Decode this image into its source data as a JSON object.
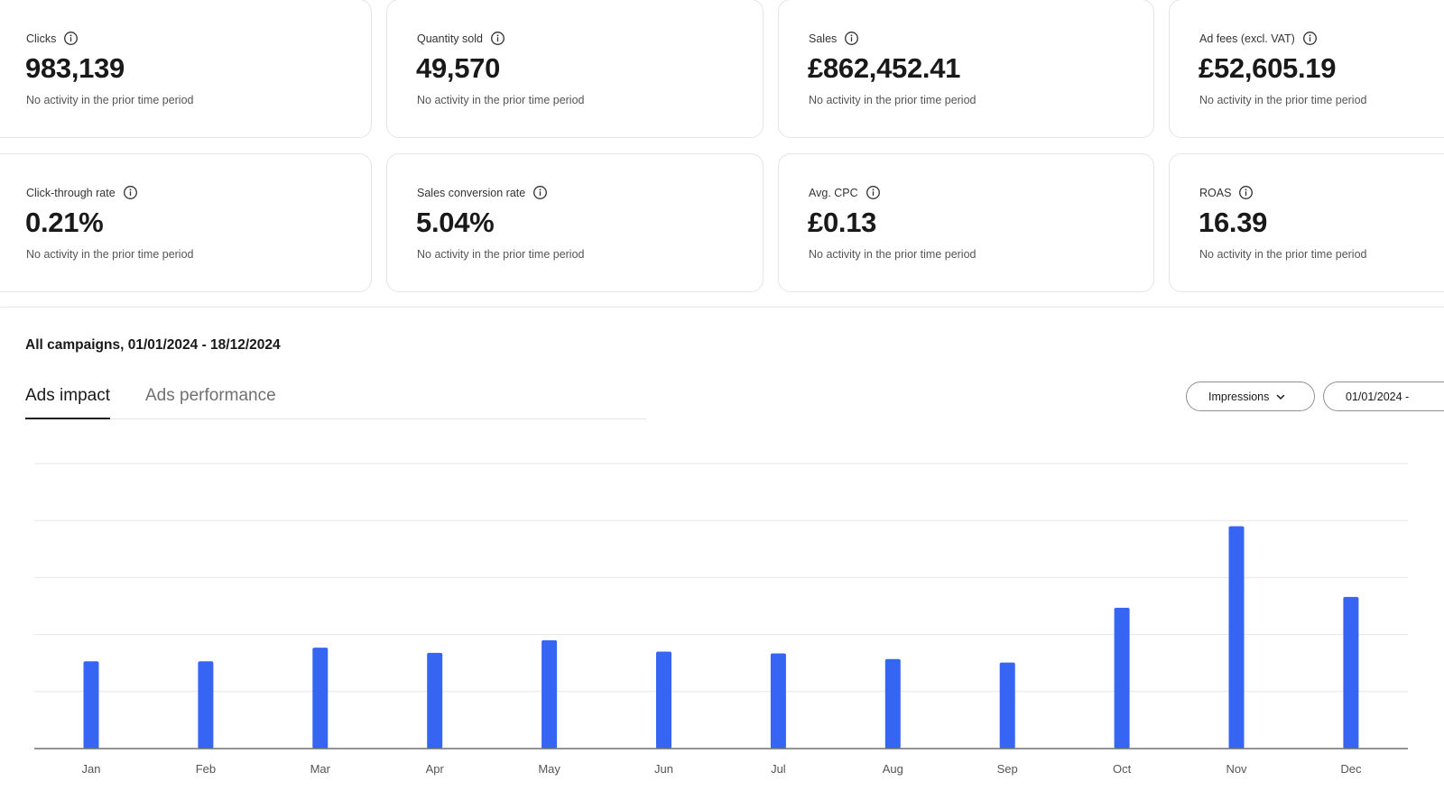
{
  "metrics": [
    {
      "label": "Clicks",
      "value": "983,139",
      "sub": "No activity in the prior time period"
    },
    {
      "label": "Quantity sold",
      "value": "49,570",
      "sub": "No activity in the prior time period"
    },
    {
      "label": "Sales",
      "value": "£862,452.41",
      "sub": "No activity in the prior time period"
    },
    {
      "label": "Ad fees (excl. VAT)",
      "value": "£52,605.19",
      "sub": "No activity in the prior time period"
    },
    {
      "label": "Click-through rate",
      "value": "0.21%",
      "sub": "No activity in the prior time period"
    },
    {
      "label": "Sales conversion rate",
      "value": "5.04%",
      "sub": "No activity in the prior time period"
    },
    {
      "label": "Avg. CPC",
      "value": "£0.13",
      "sub": "No activity in the prior time period"
    },
    {
      "label": "ROAS",
      "value": "16.39",
      "sub": "No activity in the prior time period"
    }
  ],
  "panel": {
    "title": "All campaigns, 01/01/2024 - 18/12/2024",
    "tabs": [
      {
        "label": "Ads impact",
        "active": true
      },
      {
        "label": "Ads performance",
        "active": false
      }
    ],
    "metric_select": "Impressions",
    "date_select": "01/01/2024 -"
  },
  "colors": {
    "bar": "#3665f3",
    "grid": "#e5e5e5",
    "axis": "#707070"
  },
  "icons": {
    "info": "info-circle-icon",
    "chevron": "chevron-down-icon"
  },
  "chart_data": {
    "type": "bar",
    "categories": [
      "Jan",
      "Feb",
      "Mar",
      "Apr",
      "May",
      "Jun",
      "Jul",
      "Aug",
      "Sep",
      "Oct",
      "Nov",
      "Dec"
    ],
    "values": [
      1.53,
      1.53,
      1.77,
      1.68,
      1.9,
      1.7,
      1.67,
      1.57,
      1.51,
      2.47,
      3.9,
      2.66
    ],
    "ylim": [
      0,
      5
    ],
    "grid": true,
    "title": "",
    "xlabel": "",
    "ylabel": ""
  }
}
